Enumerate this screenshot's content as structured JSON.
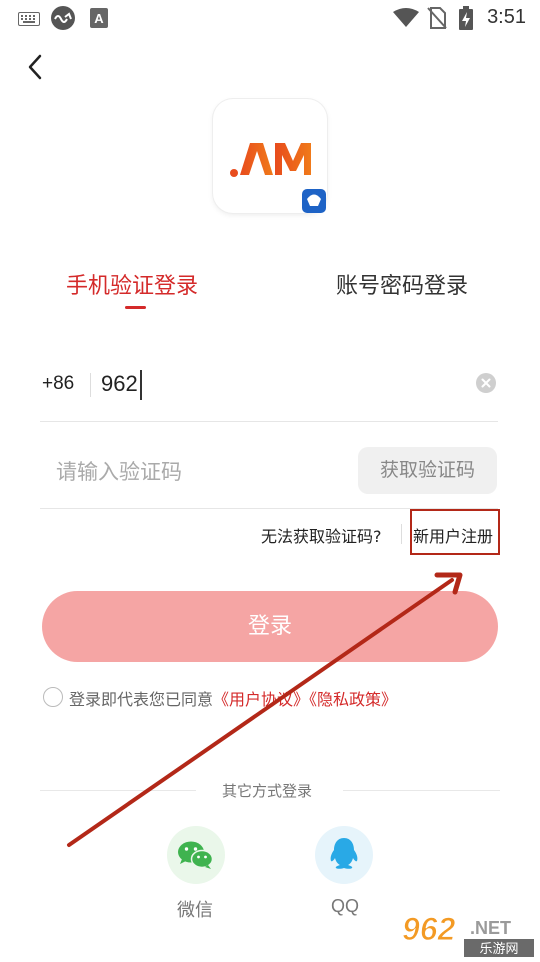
{
  "status_bar": {
    "time": "3:51",
    "icons": [
      "keyboard-icon",
      "app-loop-icon",
      "font-a-icon",
      "wifi-icon",
      "no-sim-icon",
      "battery-charging-icon"
    ]
  },
  "header": {
    "back_icon": "chevron-left-icon"
  },
  "logo": {
    "text": ".AM"
  },
  "tabs": [
    {
      "label": "手机验证登录",
      "active": true
    },
    {
      "label": "账号密码登录",
      "active": false
    }
  ],
  "phone": {
    "country_code": "+86",
    "value": "962"
  },
  "code": {
    "placeholder": "请输入验证码",
    "get_code_label": "获取验证码"
  },
  "links": {
    "cant_get_code": "无法获取验证码?",
    "register": "新用户注册"
  },
  "login_button": "登录",
  "agreement": {
    "prefix": "登录即代表您已同意",
    "user_agreement": "《用户协议》",
    "privacy_policy": "《隐私政策》"
  },
  "other_login": {
    "label": "其它方式登录",
    "options": [
      {
        "label": "微信",
        "icon": "wechat-icon"
      },
      {
        "label": "QQ",
        "icon": "qq-icon"
      }
    ]
  },
  "watermark": {
    "big": "962",
    "suffix": ".NET",
    "sub": "乐游网"
  },
  "colors": {
    "accent": "#d42a2a",
    "login_button": "#f5a5a4",
    "annotation": "#b32818"
  }
}
